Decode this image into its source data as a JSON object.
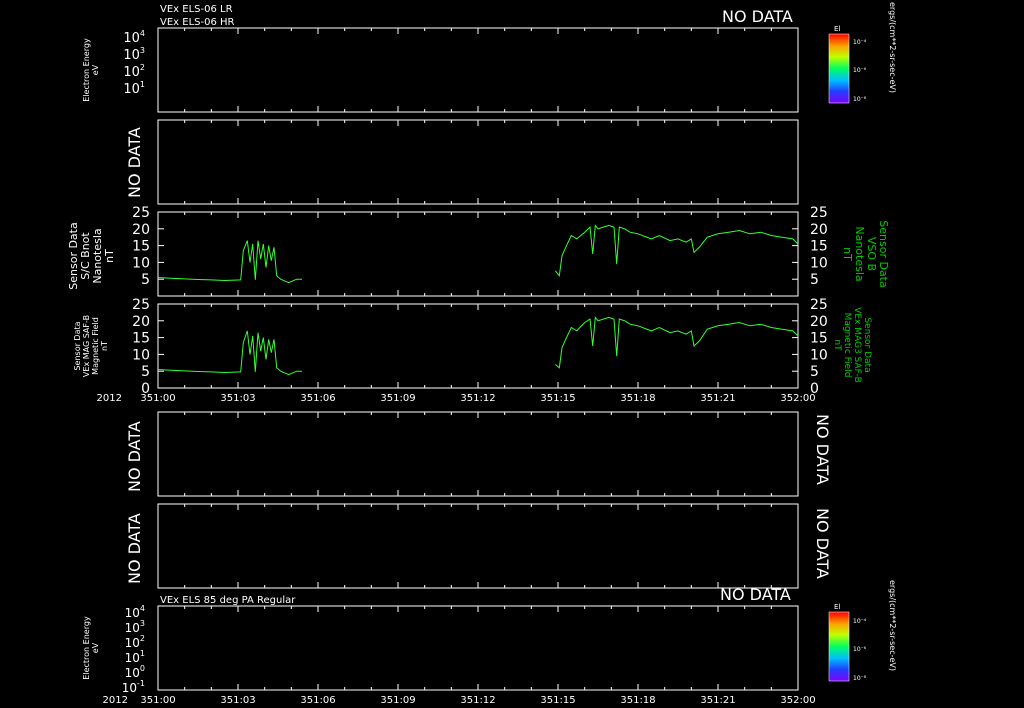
{
  "page": {
    "background": "#000000",
    "foreground": "#ffffff",
    "trace_color": "#33ff33",
    "label_green": "#00cc00"
  },
  "panel1": {
    "title1": "VEx ELS-06 LR",
    "title2": "VEx ELS-06 HR",
    "nodata": "NO DATA",
    "ylabel1": "Electron Energy",
    "ylabel2": "eV",
    "ticks": [
      {
        "base": "10",
        "exp": "4"
      },
      {
        "base": "10",
        "exp": "3"
      },
      {
        "base": "10",
        "exp": "2"
      },
      {
        "base": "10",
        "exp": "1"
      }
    ],
    "colorbar_label": "El",
    "colorbar_ticks": [
      "10⁻⁴",
      "10⁻⁶",
      "10⁻⁸"
    ],
    "units": "ergs/(cm**2-sr-sec-eV)"
  },
  "panel2": {
    "nodata": "NO DATA"
  },
  "panel3": {
    "left_label": [
      "Sensor Data",
      "S/C Bnot",
      "Nanotesla",
      "nT"
    ],
    "right_label": [
      "Sensor Data",
      "VSO B",
      "Nanotesla",
      "nT"
    ],
    "yticks": [
      "25",
      "20",
      "15",
      "10",
      "5"
    ]
  },
  "panel4": {
    "left_label": [
      "Sensor Data",
      "VEx MAG SAF-B",
      "Magnetic Field",
      "nT"
    ],
    "right_label": [
      "Sensor Data",
      "VEx MAG3 SAF-B",
      "Magnetic Field",
      "nT"
    ],
    "yticks": [
      "25",
      "20",
      "15",
      "10",
      "5",
      "0"
    ]
  },
  "axis1": {
    "year": "2012",
    "labels": [
      "351:00",
      "351:03",
      "351:06",
      "351:09",
      "351:12",
      "351:15",
      "351:18",
      "351:21",
      "352:00"
    ]
  },
  "panel5": {
    "nodata_left": "NO DATA",
    "nodata_right": "NO DATA"
  },
  "panel6": {
    "nodata_left": "NO DATA",
    "nodata_right": "NO DATA"
  },
  "panel7": {
    "title": "VEx ELS 85 deg PA Regular",
    "nodata": "NO DATA",
    "ylabel1": "Electron Energy",
    "ylabel2": "eV",
    "ticks": [
      {
        "base": "10",
        "exp": "4"
      },
      {
        "base": "10",
        "exp": "3"
      },
      {
        "base": "10",
        "exp": "2"
      },
      {
        "base": "10",
        "exp": "1"
      },
      {
        "base": "10",
        "exp": "0"
      },
      {
        "base": "10",
        "exp": "-1"
      }
    ],
    "colorbar_label": "El",
    "colorbar_ticks": [
      "10⁻⁴",
      "10⁻⁶",
      "10⁻⁸"
    ],
    "units": "ergs/(cm**2-sr-sec-eV)"
  },
  "axis2": {
    "year": "2012",
    "labels": [
      "351:00",
      "351:03",
      "351:06",
      "351:09",
      "351:12",
      "351:15",
      "351:18",
      "351:21",
      "352:00"
    ]
  },
  "chart_data": [
    {
      "type": "line",
      "ylim": [
        0,
        25
      ],
      "series": [
        {
          "values_x": [
            0.0,
            0.5,
            1.0,
            1.5,
            2.0,
            2.5,
            3.1,
            3.2,
            3.35,
            3.45,
            3.55,
            3.65,
            3.75,
            3.85,
            3.95,
            4.05,
            4.15,
            4.25,
            4.35,
            4.45,
            4.6,
            4.75,
            4.9,
            5.2,
            5.4
          ],
          "values_y": [
            5.5,
            5.3,
            5.1,
            4.9,
            4.8,
            4.6,
            4.8,
            13.5,
            16.5,
            10.0,
            15.5,
            4.8,
            16.5,
            11.0,
            15.5,
            8.5,
            15.0,
            10.5,
            14.5,
            6.0,
            5.0,
            4.5,
            4.0,
            5.0,
            5.0
          ],
          "values_x2": [
            14.9,
            15.05,
            15.15,
            15.35,
            15.5,
            15.7,
            16.0,
            16.2,
            16.3,
            16.4,
            16.5,
            16.7,
            16.9,
            17.1,
            17.2,
            17.3,
            17.5,
            17.7,
            18.0,
            18.5,
            18.8,
            19.2,
            19.5,
            19.8,
            20.0,
            20.1,
            20.3,
            20.6,
            21.0,
            21.4,
            21.8,
            22.2,
            22.6,
            23.0,
            23.4,
            23.8,
            24.0
          ],
          "values_y2": [
            7.5,
            6.0,
            12.0,
            15.5,
            18.0,
            17.0,
            19.0,
            20.5,
            12.5,
            21.0,
            20.0,
            20.5,
            21.0,
            20.5,
            9.5,
            20.5,
            20.0,
            19.0,
            18.5,
            17.0,
            18.0,
            16.5,
            17.0,
            16.0,
            17.0,
            13.0,
            14.5,
            17.5,
            18.5,
            19.0,
            19.5,
            18.5,
            19.0,
            18.0,
            17.5,
            17.0,
            15.5
          ]
        }
      ]
    },
    {
      "type": "line",
      "ylim": [
        0,
        25
      ],
      "series": [
        {
          "values_x": [
            0.0,
            0.5,
            1.0,
            1.5,
            2.0,
            2.5,
            3.1,
            3.2,
            3.35,
            3.45,
            3.55,
            3.65,
            3.75,
            3.85,
            3.95,
            4.05,
            4.15,
            4.25,
            4.35,
            4.45,
            4.6,
            4.75,
            4.9,
            5.2,
            5.4
          ],
          "values_y": [
            5.5,
            5.3,
            5.1,
            4.9,
            4.8,
            4.6,
            4.8,
            13.5,
            17.0,
            10.0,
            15.5,
            4.8,
            16.5,
            11.0,
            15.0,
            8.5,
            14.5,
            10.5,
            14.5,
            6.0,
            5.0,
            4.5,
            4.0,
            5.0,
            5.0
          ],
          "values_x2": [
            14.9,
            15.05,
            15.15,
            15.35,
            15.5,
            15.7,
            16.0,
            16.2,
            16.3,
            16.4,
            16.5,
            16.7,
            16.9,
            17.1,
            17.2,
            17.3,
            17.5,
            17.7,
            18.0,
            18.5,
            18.8,
            19.2,
            19.5,
            19.8,
            20.0,
            20.1,
            20.3,
            20.6,
            21.0,
            21.4,
            21.8,
            22.2,
            22.6,
            23.0,
            23.4,
            23.8,
            24.0
          ],
          "values_y2": [
            7.0,
            6.0,
            12.0,
            15.5,
            18.0,
            17.0,
            19.5,
            20.5,
            12.5,
            21.0,
            20.0,
            20.5,
            21.0,
            20.5,
            9.5,
            20.5,
            20.0,
            19.0,
            18.5,
            17.0,
            18.0,
            16.5,
            17.0,
            16.0,
            17.0,
            12.5,
            14.0,
            17.5,
            18.5,
            19.0,
            19.5,
            18.5,
            19.0,
            18.0,
            17.5,
            17.0,
            15.5
          ]
        }
      ]
    }
  ]
}
